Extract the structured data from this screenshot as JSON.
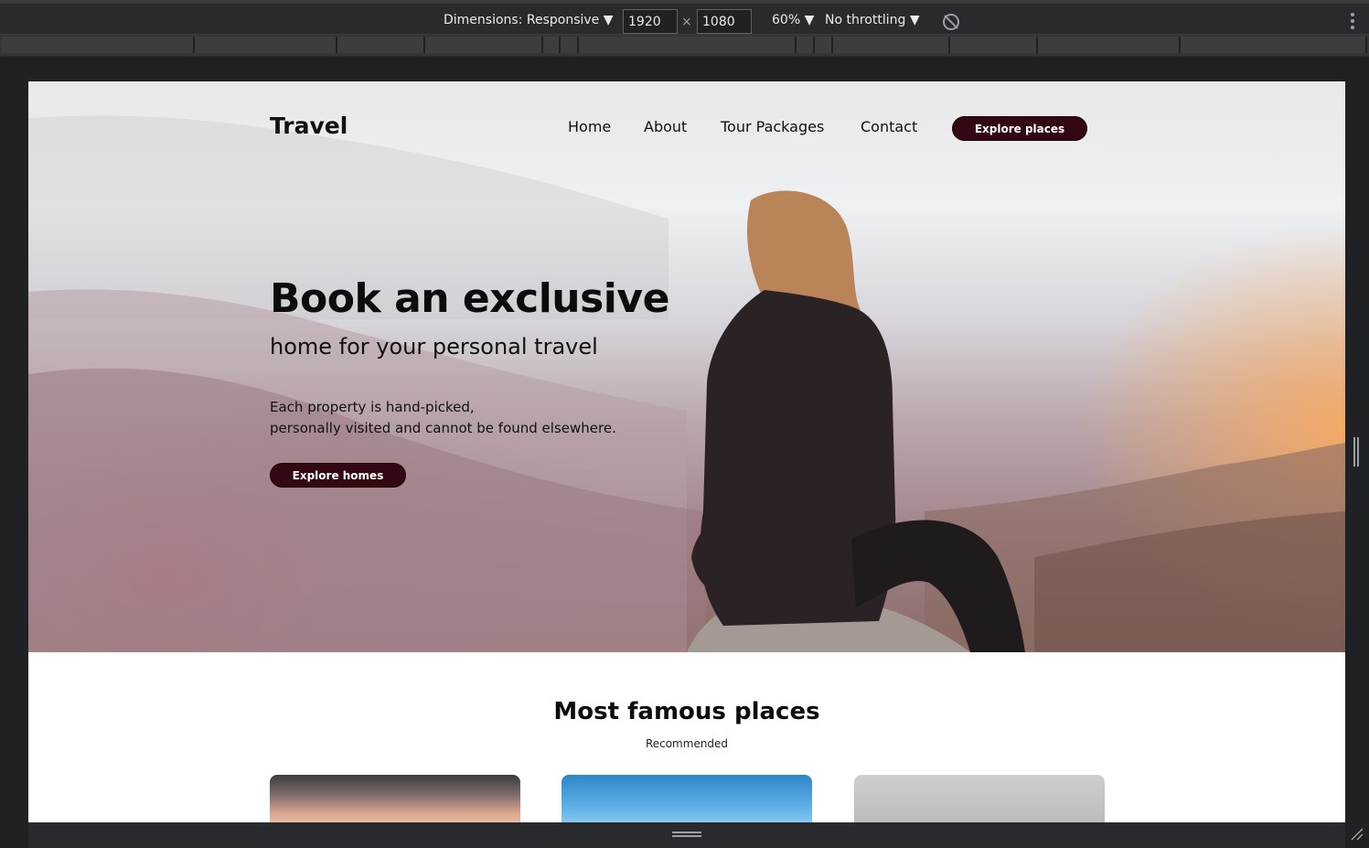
{
  "devtools": {
    "dimensions_label": "Dimensions: Responsive ▼",
    "width_value": "1920",
    "times": "×",
    "height_value": "1080",
    "zoom_label": "60% ▼",
    "throttling_label": "No throttling ▼"
  },
  "site": {
    "logo": "Travel",
    "nav": {
      "home": "Home",
      "about": "About",
      "tour_packages": "Tour Packages",
      "contact": "Contact",
      "cta": "Explore places"
    },
    "hero": {
      "title": "Book an exclusive",
      "subtitle": "home for your personal travel",
      "desc_line1": "Each property is hand-picked,",
      "desc_line2": "personally visited and cannot be found elsewhere.",
      "cta": "Explore homes"
    },
    "section": {
      "title": "Most famous places",
      "subtitle": "Recommended"
    }
  },
  "colors": {
    "button_bg": "#330812",
    "devtools_bg": "#292a2d",
    "page_bg": "#ffffff"
  }
}
